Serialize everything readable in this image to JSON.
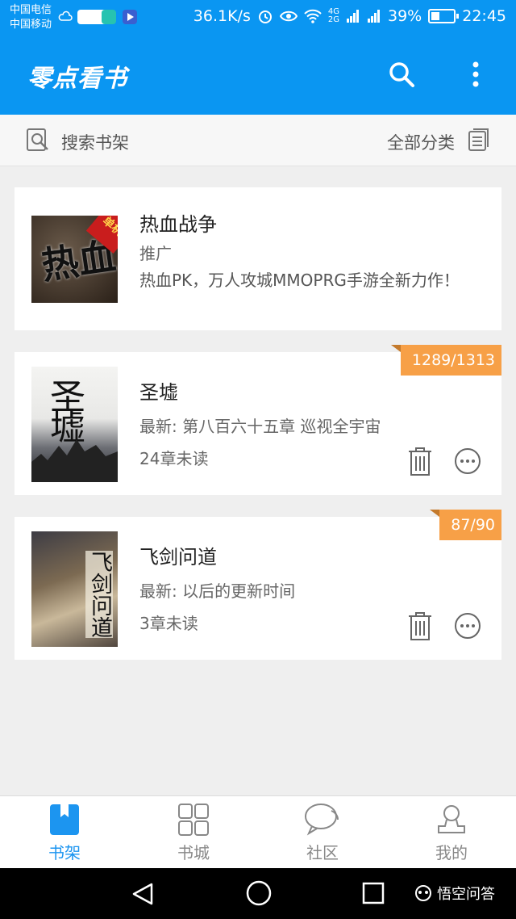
{
  "status_bar": {
    "carrier_1": "中国电信",
    "carrier_2": "中国移动",
    "net_speed": "36.1K/s",
    "net_4g": "4G",
    "net_2g": "2G",
    "battery": "39%",
    "battery_level": 0.39,
    "time": "22:45"
  },
  "app_bar": {
    "title": "零点看书",
    "search_icon": "search-icon",
    "more_icon": "more-vertical-icon"
  },
  "search_bar": {
    "placeholder": "搜索书架",
    "category": "全部分类"
  },
  "books": [
    {
      "title": "热血战争",
      "tag": "推广",
      "desc": "热血PK，万人攻城MMOPRG手游全新力作！",
      "cover_badge": "单机",
      "cover_text": "热血"
    },
    {
      "title": "圣墟",
      "latest": "最新: 第八百六十五章 巡视全宇宙",
      "unread": "24章未读",
      "progress": "1289/1313",
      "cover_text": "圣墟"
    },
    {
      "title": "飞剑问道",
      "latest": "最新: 以后的更新时间",
      "unread": "3章未读",
      "progress": "87/90",
      "cover_text": "飞剑问道"
    }
  ],
  "bottom_nav": [
    {
      "label": "书架",
      "icon": "bookshelf-icon",
      "active": true
    },
    {
      "label": "书城",
      "icon": "grid-icon",
      "active": false
    },
    {
      "label": "社区",
      "icon": "chat-bubble-icon",
      "active": false
    },
    {
      "label": "我的",
      "icon": "user-icon",
      "active": false
    }
  ],
  "watermark": "悟空问答",
  "colors": {
    "primary": "#0a96f2",
    "badge": "#f7a047",
    "nav_active": "#1c95f0"
  }
}
